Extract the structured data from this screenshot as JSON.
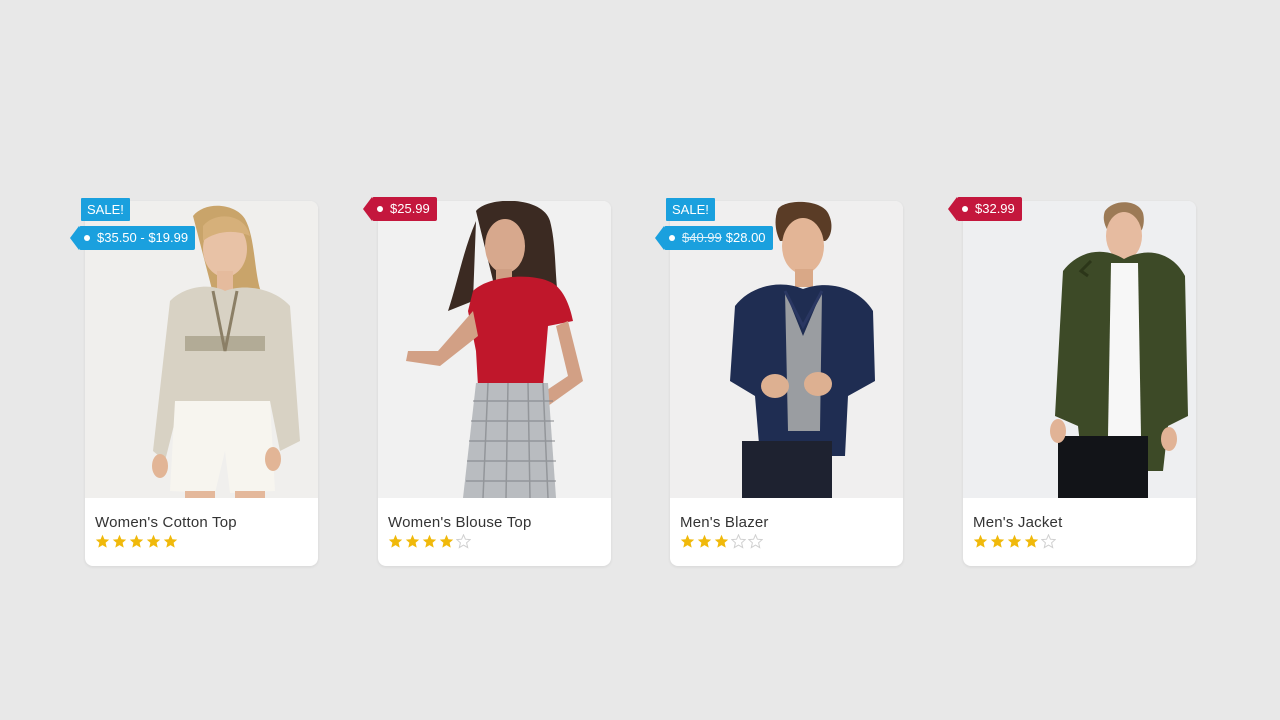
{
  "colors": {
    "sale_blue": "#1aa0de",
    "price_red": "#c4173d",
    "star_gold": "#f0b90b",
    "star_empty": "#cfcfcf"
  },
  "products": [
    {
      "name": "Women's Cotton Top",
      "badge": "SALE!",
      "price_old": "",
      "price": "$35.50 - $19.99",
      "rating": 5,
      "rating_max": 5
    },
    {
      "name": "Women's Blouse Top",
      "badge": "",
      "price_old": "",
      "price": "$25.99",
      "rating": 4,
      "rating_max": 5
    },
    {
      "name": "Men's Blazer",
      "badge": "SALE!",
      "price_old": "$40.99",
      "price": "$28.00",
      "rating": 3,
      "rating_max": 5
    },
    {
      "name": "Men's Jacket",
      "badge": "",
      "price_old": "",
      "price": "$32.99",
      "rating": 4,
      "rating_max": 5
    }
  ]
}
